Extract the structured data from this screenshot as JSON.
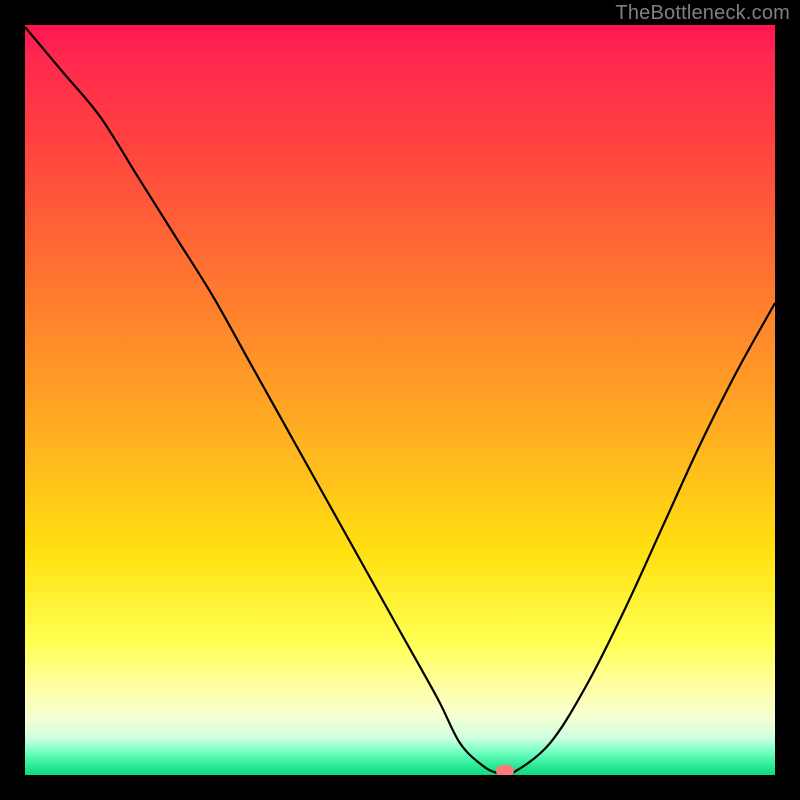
{
  "watermark": "TheBottleneck.com",
  "colors": {
    "frame": "#000000",
    "watermark": "#808080",
    "curve": "#000000",
    "marker": "#ff7a7a",
    "gradient_stops": [
      "#ff1450",
      "#ff2850",
      "#ff4040",
      "#ff7830",
      "#ffb020",
      "#ffe010",
      "#ffff50",
      "#ffffa0",
      "#f8ffd0",
      "#d0ffe0",
      "#70ffc0",
      "#20e890",
      "#10d880"
    ]
  },
  "chart_data": {
    "type": "line",
    "title": "",
    "xlabel": "",
    "ylabel": "",
    "xlim": [
      0,
      100
    ],
    "ylim": [
      0,
      100
    ],
    "x": [
      0,
      5,
      10,
      15,
      20,
      25,
      30,
      35,
      40,
      45,
      50,
      55,
      58,
      61,
      63,
      65,
      70,
      75,
      80,
      85,
      90,
      95,
      100
    ],
    "values": [
      100,
      94,
      88,
      80,
      72,
      64,
      55,
      46,
      37,
      28,
      19,
      10,
      4,
      1,
      0,
      0,
      4,
      12,
      22,
      33,
      44,
      54,
      63
    ],
    "flat_bottom_x": [
      61,
      65
    ],
    "marker": {
      "x": 64,
      "y": 0
    },
    "note": "y represents bottleneck percentage (100=top/red=bad fit, 0=bottom/green=ideal). Values estimated from curve pixel positions; no numeric axes visible."
  }
}
